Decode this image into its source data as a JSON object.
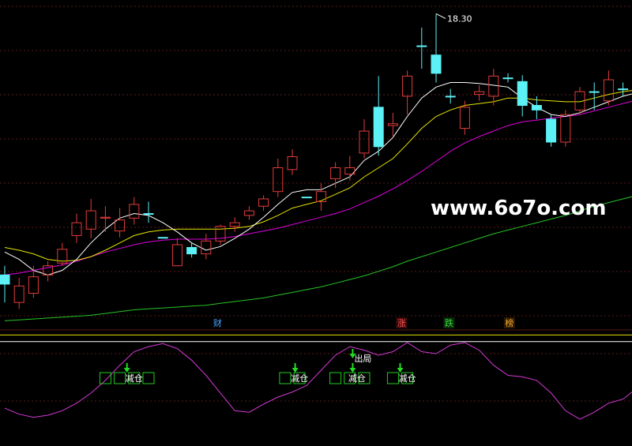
{
  "chart_data": {
    "type": "candlestick",
    "price_panel": {
      "max_price_label": "18.30",
      "ylim": [
        14.85,
        18.45
      ],
      "candles": [
        {
          "o": 15.35,
          "h": 15.55,
          "l": 15.15,
          "c": 15.45,
          "up": false
        },
        {
          "o": 15.15,
          "h": 15.42,
          "l": 15.08,
          "c": 15.33,
          "up": true
        },
        {
          "o": 15.25,
          "h": 15.55,
          "l": 15.2,
          "c": 15.43,
          "up": true
        },
        {
          "o": 15.45,
          "h": 15.6,
          "l": 15.38,
          "c": 15.55,
          "up": true
        },
        {
          "o": 15.58,
          "h": 15.8,
          "l": 15.55,
          "c": 15.73,
          "up": true
        },
        {
          "o": 15.88,
          "h": 16.12,
          "l": 15.8,
          "c": 16.02,
          "up": true
        },
        {
          "o": 15.95,
          "h": 16.28,
          "l": 15.85,
          "c": 16.15,
          "up": true
        },
        {
          "o": 16.07,
          "h": 16.2,
          "l": 15.92,
          "c": 16.08,
          "up": true
        },
        {
          "o": 15.93,
          "h": 16.18,
          "l": 15.86,
          "c": 16.05,
          "up": true
        },
        {
          "o": 16.07,
          "h": 16.3,
          "l": 16.0,
          "c": 16.22,
          "up": true
        },
        {
          "o": 16.12,
          "h": 16.25,
          "l": 16.02,
          "c": 16.12,
          "up": false
        },
        {
          "o": 15.86,
          "h": 15.86,
          "l": 15.86,
          "c": 15.86,
          "up": false
        },
        {
          "o": 15.55,
          "h": 15.85,
          "l": 15.55,
          "c": 15.78,
          "up": true
        },
        {
          "o": 15.75,
          "h": 15.8,
          "l": 15.64,
          "c": 15.68,
          "up": false
        },
        {
          "o": 15.68,
          "h": 15.9,
          "l": 15.62,
          "c": 15.82,
          "up": true
        },
        {
          "o": 15.82,
          "h": 16.0,
          "l": 15.78,
          "c": 15.98,
          "up": true
        },
        {
          "o": 15.98,
          "h": 16.08,
          "l": 15.92,
          "c": 16.02,
          "up": true
        },
        {
          "o": 16.1,
          "h": 16.2,
          "l": 16.05,
          "c": 16.15,
          "up": true
        },
        {
          "o": 16.2,
          "h": 16.32,
          "l": 16.15,
          "c": 16.28,
          "up": true
        },
        {
          "o": 16.36,
          "h": 16.72,
          "l": 16.3,
          "c": 16.62,
          "up": true
        },
        {
          "o": 16.6,
          "h": 16.82,
          "l": 16.54,
          "c": 16.74,
          "up": true
        },
        {
          "o": 16.3,
          "h": 16.3,
          "l": 16.3,
          "c": 16.3,
          "up": false
        },
        {
          "o": 16.25,
          "h": 16.45,
          "l": 16.15,
          "c": 16.36,
          "up": true
        },
        {
          "o": 16.5,
          "h": 16.68,
          "l": 16.4,
          "c": 16.62,
          "up": true
        },
        {
          "o": 16.55,
          "h": 16.75,
          "l": 16.48,
          "c": 16.62,
          "up": true
        },
        {
          "o": 16.78,
          "h": 17.15,
          "l": 16.72,
          "c": 17.02,
          "up": true
        },
        {
          "o": 17.28,
          "h": 17.62,
          "l": 16.75,
          "c": 16.85,
          "up": false
        },
        {
          "o": 17.1,
          "h": 17.22,
          "l": 16.95,
          "c": 17.08,
          "up": true
        },
        {
          "o": 17.4,
          "h": 17.68,
          "l": 17.2,
          "c": 17.62,
          "up": true
        },
        {
          "o": 17.95,
          "h": 18.15,
          "l": 17.7,
          "c": 17.95,
          "up": false
        },
        {
          "o": 17.85,
          "h": 18.3,
          "l": 17.55,
          "c": 17.65,
          "up": false
        },
        {
          "o": 17.4,
          "h": 17.48,
          "l": 17.32,
          "c": 17.4,
          "up": false
        },
        {
          "o": 17.05,
          "h": 17.35,
          "l": 16.98,
          "c": 17.28,
          "up": true
        },
        {
          "o": 17.42,
          "h": 17.52,
          "l": 17.35,
          "c": 17.45,
          "up": true
        },
        {
          "o": 17.4,
          "h": 17.7,
          "l": 17.3,
          "c": 17.62,
          "up": true
        },
        {
          "o": 17.6,
          "h": 17.65,
          "l": 17.55,
          "c": 17.6,
          "up": false
        },
        {
          "o": 17.56,
          "h": 17.63,
          "l": 17.18,
          "c": 17.3,
          "up": false
        },
        {
          "o": 17.3,
          "h": 17.4,
          "l": 17.15,
          "c": 17.25,
          "up": false
        },
        {
          "o": 17.15,
          "h": 17.2,
          "l": 16.85,
          "c": 16.9,
          "up": false
        },
        {
          "o": 16.9,
          "h": 17.25,
          "l": 16.85,
          "c": 17.2,
          "up": true
        },
        {
          "o": 17.25,
          "h": 17.5,
          "l": 17.2,
          "c": 17.45,
          "up": true
        },
        {
          "o": 17.45,
          "h": 17.55,
          "l": 17.25,
          "c": 17.45,
          "up": false
        },
        {
          "o": 17.35,
          "h": 17.68,
          "l": 17.3,
          "c": 17.58,
          "up": true
        },
        {
          "o": 17.48,
          "h": 17.55,
          "l": 17.4,
          "c": 17.48,
          "up": false
        },
        {
          "o": 17.4,
          "h": 17.58,
          "l": 17.36,
          "c": 17.42,
          "up": false
        },
        {
          "o": 17.3,
          "h": 17.4,
          "l": 17.25,
          "c": 17.35,
          "up": true
        }
      ],
      "ma_white": [
        15.7,
        15.62,
        15.5,
        15.45,
        15.5,
        15.62,
        15.8,
        15.95,
        16.07,
        16.12,
        16.1,
        16.02,
        15.92,
        15.8,
        15.72,
        15.76,
        15.85,
        15.95,
        16.08,
        16.22,
        16.35,
        16.38,
        16.38,
        16.45,
        16.52,
        16.7,
        16.8,
        16.95,
        17.18,
        17.38,
        17.5,
        17.55,
        17.55,
        17.54,
        17.52,
        17.5,
        17.38,
        17.28,
        17.2,
        17.18,
        17.22,
        17.28,
        17.34,
        17.4,
        17.44,
        17.4
      ],
      "ma_yellow": [
        15.75,
        15.72,
        15.68,
        15.62,
        15.6,
        15.61,
        15.65,
        15.72,
        15.8,
        15.88,
        15.92,
        15.94,
        15.95,
        15.95,
        15.95,
        15.95,
        15.96,
        15.98,
        16.03,
        16.1,
        16.18,
        16.22,
        16.26,
        16.33,
        16.4,
        16.52,
        16.62,
        16.72,
        16.88,
        17.05,
        17.18,
        17.25,
        17.3,
        17.32,
        17.34,
        17.38,
        17.38,
        17.36,
        17.35,
        17.34,
        17.34,
        17.38,
        17.42,
        17.45,
        17.47,
        17.42
      ],
      "ma_magenta": [
        15.45,
        15.47,
        15.5,
        15.53,
        15.56,
        15.6,
        15.65,
        15.7,
        15.74,
        15.78,
        15.81,
        15.83,
        15.84,
        15.84,
        15.84,
        15.85,
        15.87,
        15.9,
        15.93,
        15.96,
        16.0,
        16.04,
        16.08,
        16.12,
        16.17,
        16.24,
        16.31,
        16.39,
        16.48,
        16.58,
        16.69,
        16.8,
        16.89,
        16.96,
        17.02,
        17.08,
        17.12,
        17.14,
        17.16,
        17.18,
        17.2,
        17.24,
        17.28,
        17.32,
        17.36,
        17.4
      ],
      "ma_green": [
        14.95,
        14.96,
        14.97,
        14.98,
        14.99,
        15.0,
        15.01,
        15.03,
        15.05,
        15.07,
        15.08,
        15.09,
        15.1,
        15.11,
        15.12,
        15.14,
        15.16,
        15.18,
        15.2,
        15.23,
        15.26,
        15.29,
        15.32,
        15.36,
        15.4,
        15.44,
        15.49,
        15.54,
        15.6,
        15.65,
        15.7,
        15.75,
        15.8,
        15.85,
        15.9,
        15.94,
        15.98,
        16.02,
        16.06,
        16.1,
        16.15,
        16.2,
        16.24,
        16.28,
        16.32,
        16.37
      ]
    },
    "event_markers": [
      {
        "text": "财",
        "candle": 14.8,
        "color": "#4aa3ff",
        "bg": "#000000"
      },
      {
        "text": "涨",
        "candle": 27.6,
        "color": "#ff5555",
        "bg": "#3a0a0a"
      },
      {
        "text": "跌",
        "candle": 30.9,
        "color": "#33dd33",
        "bg": "#0a2a0a"
      },
      {
        "text": "榜",
        "candle": 35.1,
        "color": "#ffaa33",
        "bg": "#2a1a00"
      }
    ],
    "indicator_panel": {
      "ylim": [
        -1.25,
        1.05
      ],
      "upper_line": 0.95,
      "mid_line": 0.82,
      "signal_line": [
        -0.5,
        -0.62,
        -0.68,
        -0.64,
        -0.55,
        -0.4,
        -0.2,
        0.05,
        0.35,
        0.62,
        0.72,
        0.78,
        0.68,
        0.45,
        0.15,
        -0.2,
        -0.55,
        -0.58,
        -0.42,
        -0.28,
        -0.18,
        -0.05,
        0.25,
        0.55,
        0.72,
        0.65,
        0.55,
        0.62,
        0.8,
        0.62,
        0.58,
        0.75,
        0.8,
        0.65,
        0.35,
        0.15,
        0.12,
        0.05,
        -0.2,
        -0.55,
        -0.72,
        -0.58,
        -0.4,
        -0.32,
        -0.1,
        -0.05,
        -0.1
      ],
      "reduce_label": "减仓",
      "exit_label": "出局",
      "reduce_signals": [
        {
          "boxes": [
            7.0,
            8.0,
            9.0,
            10.0
          ],
          "label_box": 9,
          "arrow": 8.5
        },
        {
          "boxes": [
            19.5,
            20.5
          ],
          "label_box": 20.5,
          "arrow": 20.2
        },
        {
          "boxes": [
            23.0,
            24.0,
            25.0
          ],
          "label_box": 24.5,
          "arrow": 24.2
        },
        {
          "boxes": [
            27.0,
            28.0
          ],
          "label_box": 28,
          "arrow": 27.5
        }
      ],
      "exit_signal": {
        "arrow": 24.2
      }
    },
    "grid": true,
    "watermark": "www.6o7o.com"
  },
  "colors": {
    "up": "#e23b3b",
    "down": "#5cf1f5",
    "ma_white": "#ffffff",
    "ma_yellow": "#e6e600",
    "ma_magenta": "#e000e0",
    "ma_green": "#26c426",
    "grid": "#5a1a1a",
    "signal": "#d43ad4",
    "box": "#22cc22",
    "arrow": "#22dd22",
    "upper_line": "#e0e000",
    "mid_line": "#ffffff"
  }
}
